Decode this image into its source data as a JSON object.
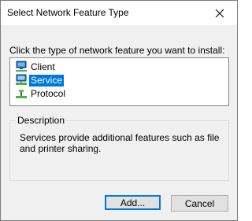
{
  "window": {
    "title": "Select Network Feature Type"
  },
  "prompt": "Click the type of network feature you want to install:",
  "list": {
    "items": [
      {
        "label": "Client",
        "icon": "client-network-icon"
      },
      {
        "label": "Service",
        "icon": "service-network-icon",
        "selected": true
      },
      {
        "label": "Protocol",
        "icon": "protocol-network-icon"
      }
    ]
  },
  "description": {
    "group_label": "Description",
    "text": "Services provide additional features such as file and printer sharing."
  },
  "buttons": {
    "add": "Add...",
    "cancel": "Cancel"
  },
  "colors": {
    "selection": "#0078d7",
    "dialog_bg": "#f0f0f0"
  }
}
